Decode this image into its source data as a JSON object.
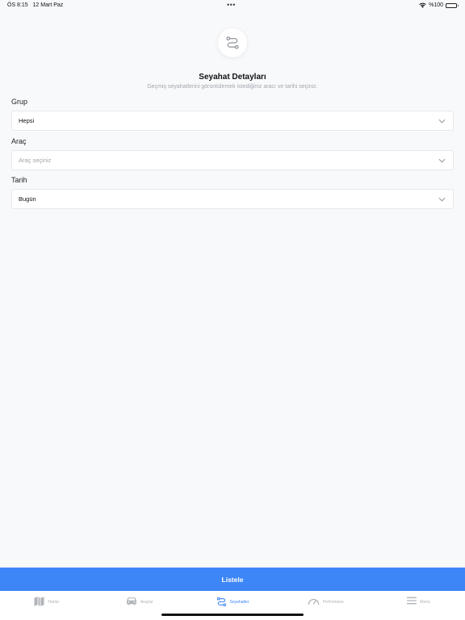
{
  "status_bar": {
    "time": "ÖS 8:15",
    "date": "12 Mart Paz",
    "dots": "•••",
    "battery": "%100"
  },
  "header": {
    "icon": "route-icon",
    "title": "Seyahat Detayları",
    "subtitle": "Geçmiş seyahatlerini görüntülemek istediğiniz aracı ve tarihi seçiniz."
  },
  "form": {
    "group": {
      "label": "Grup",
      "value": "Hepsi"
    },
    "vehicle": {
      "label": "Araç",
      "placeholder": "Araç seçiniz"
    },
    "date": {
      "label": "Tarih",
      "value": "Bugün"
    }
  },
  "actions": {
    "list_label": "Listele"
  },
  "tabs": [
    {
      "label": "Harita",
      "icon": "map-icon",
      "active": false
    },
    {
      "label": "Araçlar",
      "icon": "car-icon",
      "active": false
    },
    {
      "label": "Seyahatler",
      "icon": "route-icon",
      "active": true
    },
    {
      "label": "Performans",
      "icon": "gauge-icon",
      "active": false
    },
    {
      "label": "Menü",
      "icon": "menu-icon",
      "active": false
    }
  ],
  "colors": {
    "accent": "#3d86f7",
    "background": "#f8f9fb",
    "inactive": "#b0b3b8"
  }
}
